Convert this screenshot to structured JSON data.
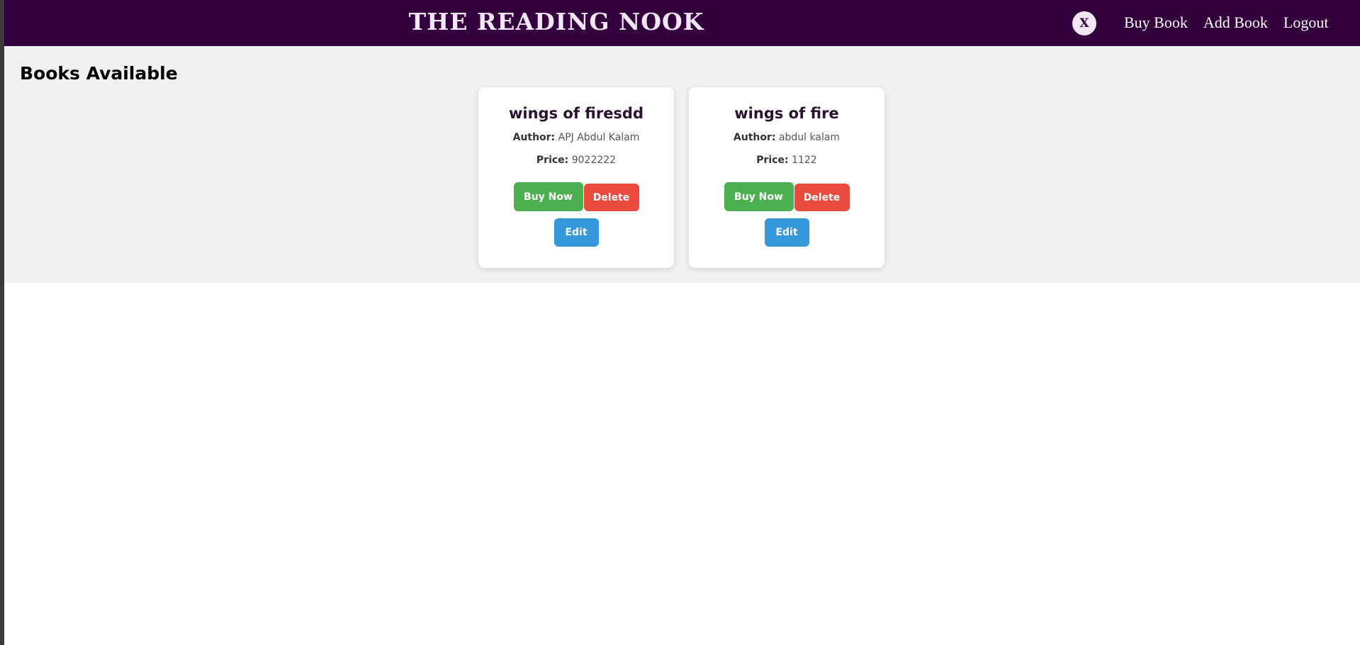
{
  "header": {
    "brand": "THE READING NOOK",
    "close_label": "X",
    "nav": {
      "buy_book": "Buy Book",
      "add_book": "Add Book",
      "logout": "Logout"
    }
  },
  "main": {
    "title": "Books Available",
    "author_label": "Author:",
    "price_label": "Price:",
    "buttons": {
      "buy": "Buy Now",
      "delete": "Delete",
      "edit": "Edit"
    },
    "books": [
      {
        "title": "wings of firesdd",
        "author": "APJ Abdul Kalam",
        "price": "9022222"
      },
      {
        "title": "wings of fire",
        "author": "abdul kalam",
        "price": "1122"
      }
    ]
  },
  "colors": {
    "navbar": "#33003d",
    "buy": "#4caf50",
    "delete": "#e94c3d",
    "edit": "#3498db"
  }
}
